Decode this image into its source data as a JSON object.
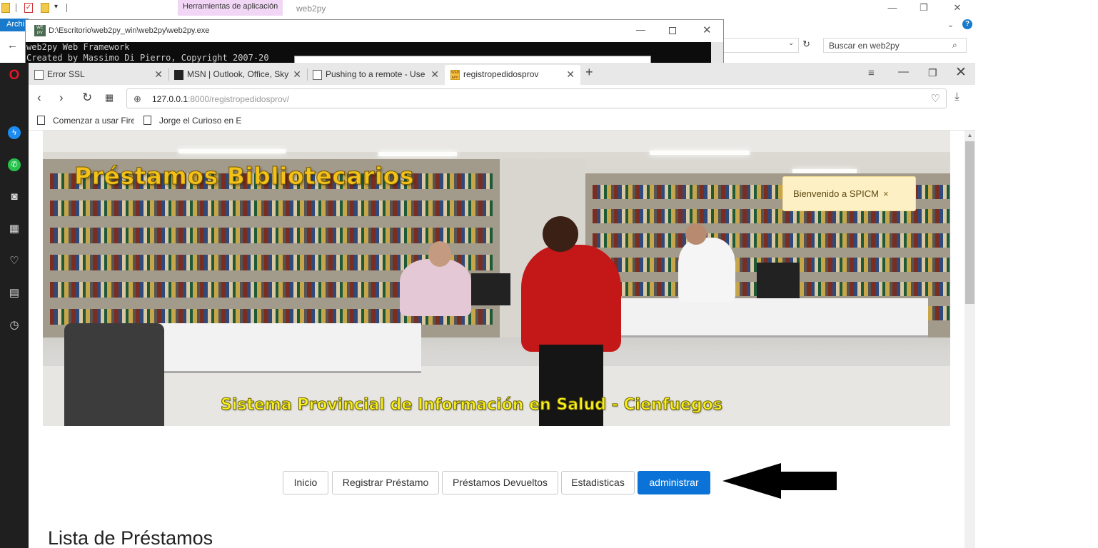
{
  "explorer": {
    "tools_tab": "Herramientas de aplicación",
    "title": "web2py",
    "archivo_tab": "Archi",
    "search_placeholder": "Buscar en web2py",
    "help_label": "?"
  },
  "console": {
    "title": "D:\\Escritorio\\web2py_win\\web2py\\web2py.exe",
    "line1": "web2py Web Framework",
    "line2": "Created by Massimo Di Pierro, Copyright 2007-20"
  },
  "browser": {
    "tabs": [
      {
        "label": "Error SSL"
      },
      {
        "label": "MSN | Outlook, Office, Sky"
      },
      {
        "label": "Pushing to a remote - Use"
      },
      {
        "label": "registropedidosprov"
      }
    ],
    "url_host": "127.0.0.1",
    "url_rest": ":8000/registropedidosprov/",
    "bookmarks": [
      {
        "label": "Comenzar a usar Firef"
      },
      {
        "label": "Jorge el Curioso en Es"
      }
    ]
  },
  "page": {
    "banner_title": "Préstamos Bibliotecarios",
    "banner_subtitle": "Sistema Provincial de Información en Salud - Cienfuegos",
    "alert_text": "Bienvenido a SPICM",
    "alert_close": "×",
    "menu": {
      "inicio": "Inicio",
      "registrar": "Registrar Préstamo",
      "devueltos": "Préstamos Devueltos",
      "estadisticas": "Estadisticas",
      "administrar": "administrar"
    },
    "list_heading": "Lista de Préstamos"
  },
  "colors": {
    "primary_button": "#0b73d8",
    "alert_bg": "#fdf0c4",
    "banner_title": "#f2c21a",
    "banner_subtitle": "#f7ee1e",
    "sidebar_bg": "#1f1f1f"
  }
}
